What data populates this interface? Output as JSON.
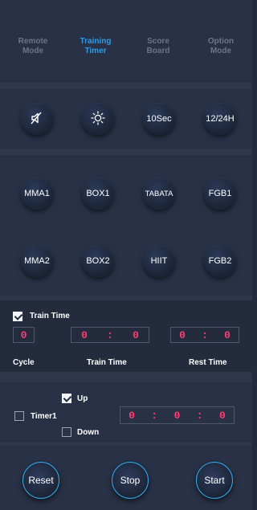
{
  "tabs": [
    {
      "line1": "Remote",
      "line2": "Mode"
    },
    {
      "line1": "Training",
      "line2": "Timer"
    },
    {
      "line1": "Score",
      "line2": "Board"
    },
    {
      "line1": "Option",
      "line2": "Mode"
    }
  ],
  "active_tab": "Training Timer",
  "top_buttons": {
    "sec": "10Sec",
    "hour": "12/24H",
    "icons": [
      "mute-icon",
      "brightness-icon"
    ]
  },
  "presets": [
    "MMA1",
    "BOX1",
    "TABATA",
    "FGB1",
    "MMA2",
    "BOX2",
    "HIIT",
    "FGB2"
  ],
  "train": {
    "checkbox_label": "Train Time",
    "checked": true,
    "cycle_value": "0",
    "train_min": "0",
    "train_sec": "0",
    "rest_min": "0",
    "rest_sec": "0",
    "colon": ":",
    "cycle_label": "Cycle",
    "train_label": "Train Time",
    "rest_label": "Rest Time"
  },
  "timer": {
    "timer_label": "Timer1",
    "timer_checked": false,
    "up_label": "Up",
    "up_checked": true,
    "down_label": "Down",
    "down_checked": false,
    "h": "0",
    "m": "0",
    "s": "0",
    "colon": ":"
  },
  "controls": {
    "reset": "Reset",
    "stop": "Stop",
    "start": "Start"
  },
  "colors": {
    "accent": "#2f9be8",
    "digits": "#ff3d73",
    "background": "#232b3d"
  }
}
